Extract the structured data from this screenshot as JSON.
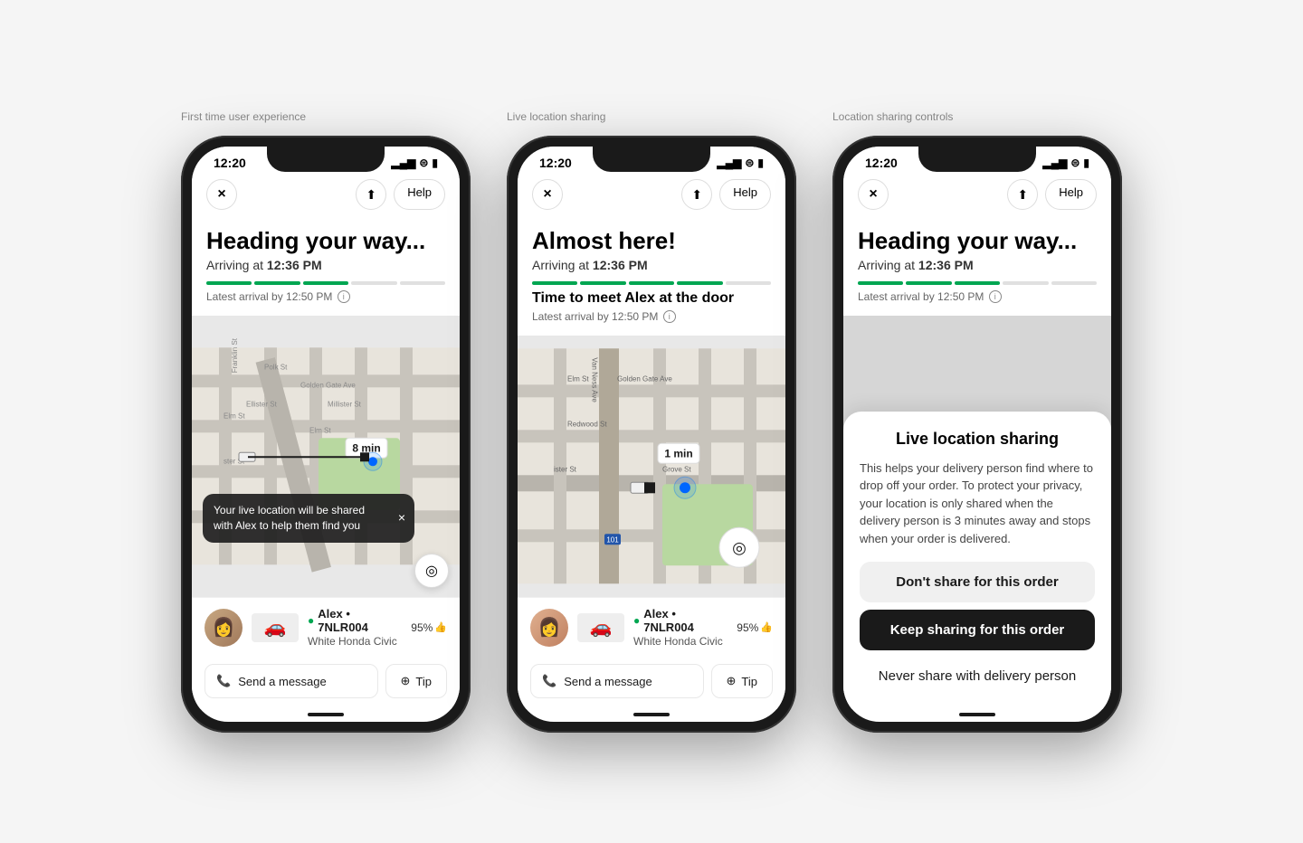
{
  "labels": {
    "screen1": "First time user experience",
    "screen2": "Live location sharing",
    "screen3": "Location sharing controls"
  },
  "status": {
    "time": "12:20",
    "signal": "▂▄▆",
    "wifi": "WiFi",
    "battery": "Battery"
  },
  "nav": {
    "close": "×",
    "share_icon": "↑",
    "help": "Help"
  },
  "phone1": {
    "heading": "Heading your way...",
    "arriving": "Arriving at",
    "arriving_time": "12:36 PM",
    "latest_arrival": "Latest arrival by 12:50 PM",
    "eta_label": "8 min",
    "toast_text": "Your live location will be shared with Alex to help them find you",
    "driver_name": "Alex • 7NLR004",
    "driver_car": "White Honda Civic",
    "rating": "95%",
    "send_message": "Send a message",
    "tip": "Tip"
  },
  "phone2": {
    "heading": "Almost here!",
    "arriving": "Arriving at",
    "arriving_time": "12:36 PM",
    "sub_heading": "Time to meet Alex at the door",
    "latest_arrival": "Latest arrival by 12:50 PM",
    "eta_label": "1 min",
    "driver_name": "Alex • 7NLR004",
    "driver_car": "White Honda Civic",
    "rating": "95%",
    "send_message": "Send a message",
    "tip": "Tip"
  },
  "phone3": {
    "heading": "Heading your way...",
    "arriving": "Arriving at",
    "arriving_time": "12:36 PM",
    "latest_arrival": "Latest arrival by 12:50 PM",
    "sheet_title": "Live location sharing",
    "sheet_desc": "This helps your delivery person find where to drop off your order. To protect your privacy, your location is only shared when the delivery person is 3 minutes away and stops when your order is delivered.",
    "btn_dont_share": "Don't share for this order",
    "btn_keep_sharing": "Keep sharing for this order",
    "btn_never_share": "Never share with delivery person"
  }
}
